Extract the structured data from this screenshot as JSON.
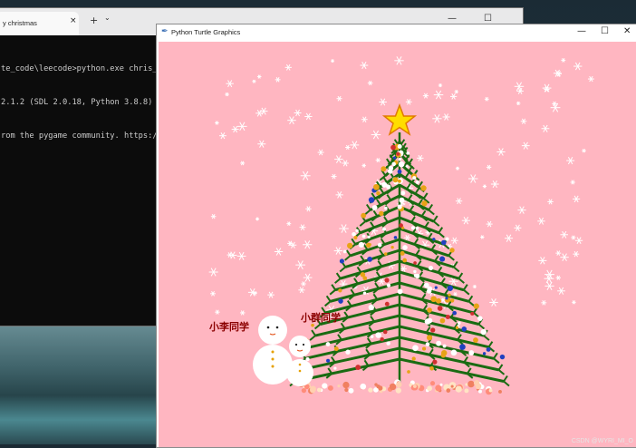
{
  "terminal": {
    "tab_title": "y christmas",
    "tab_close": "×",
    "new_tab": "+",
    "dropdown": "⌄",
    "minimize": "—",
    "maximize": "☐",
    "close": "✕",
    "lines": [
      "te_code\\leecode>python.exe chris_tr",
      "2.1.2 (SDL 2.0.18, Python 3.8.8)",
      "rom the pygame community. https://w"
    ]
  },
  "turtle_window": {
    "title": "Python Turtle Graphics",
    "minimize": "—",
    "maximize": "☐",
    "close": "✕"
  },
  "scene": {
    "label_left": "小李同学",
    "label_right": "小群同学",
    "background_color": "#ffb6c1",
    "tree_color": "#1a6b12",
    "star_color": "#ffdd00"
  },
  "watermark": "CSDN @WYRI_MI_O"
}
